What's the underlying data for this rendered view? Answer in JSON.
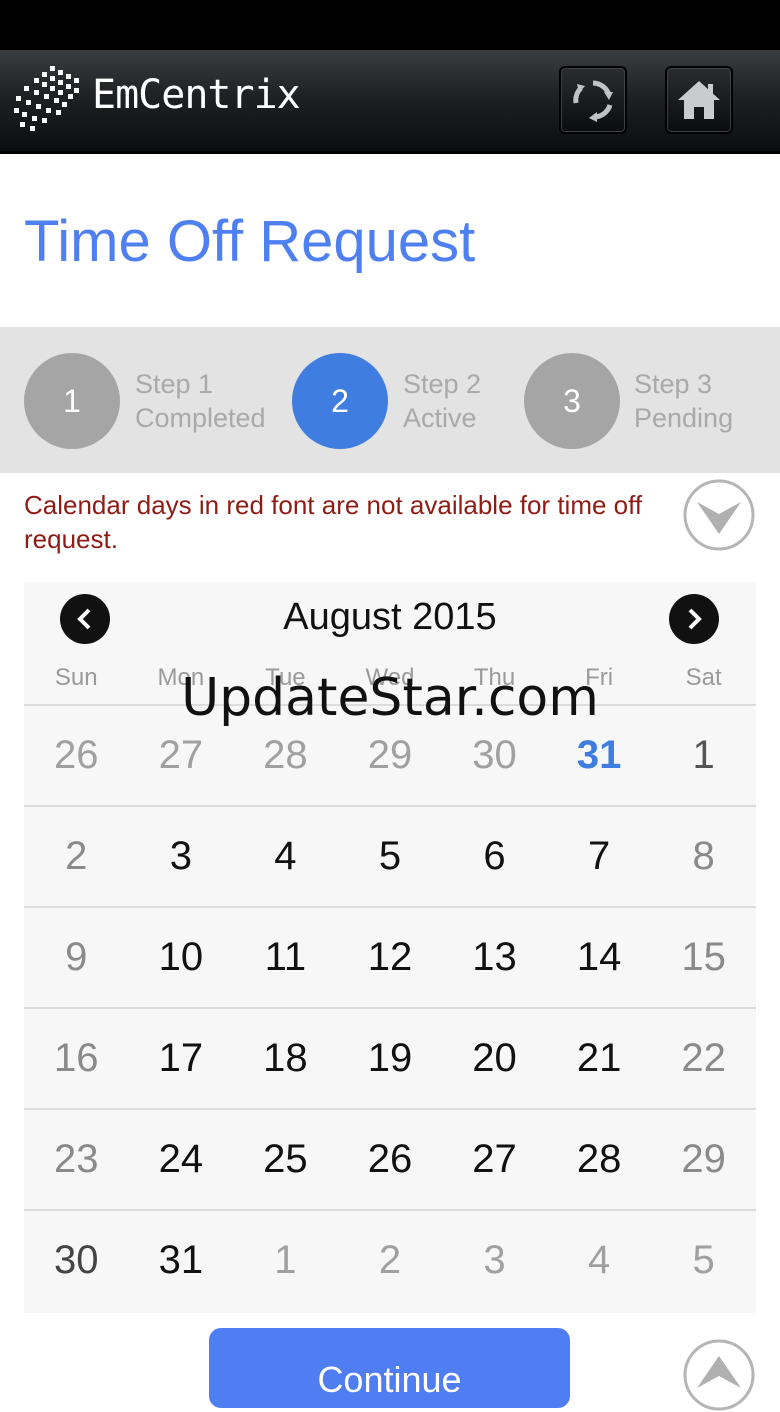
{
  "header": {
    "brand": "EmCentrix",
    "icons": {
      "logo": "emcentrix-logo-icon",
      "refresh": "refresh-icon",
      "home": "home-icon"
    }
  },
  "page": {
    "title": "Time Off Request"
  },
  "steps": [
    {
      "number": "1",
      "line1": "Step 1",
      "line2": "Completed",
      "state": "completed"
    },
    {
      "number": "2",
      "line1": "Step 2",
      "line2": "Active",
      "state": "active"
    },
    {
      "number": "3",
      "line1": "Step 3",
      "line2": "Pending",
      "state": "pending"
    }
  ],
  "notice": {
    "text": "Calendar days in red font are not available for time off request.",
    "color": "#8f1c14"
  },
  "calendar": {
    "month_label": "August 2015",
    "weekdays": [
      "Sun",
      "Mon",
      "Tue",
      "Wed",
      "Thu",
      "Fri",
      "Sat"
    ],
    "weeks": [
      [
        "26",
        "27",
        "28",
        "29",
        "30",
        "31",
        "1"
      ],
      [
        "2",
        "3",
        "4",
        "5",
        "6",
        "7",
        "8"
      ],
      [
        "9",
        "10",
        "11",
        "12",
        "13",
        "14",
        "15"
      ],
      [
        "16",
        "17",
        "18",
        "19",
        "20",
        "21",
        "22"
      ],
      [
        "23",
        "24",
        "25",
        "26",
        "27",
        "28",
        "29"
      ],
      [
        "30",
        "31",
        "1",
        "2",
        "3",
        "4",
        "5"
      ]
    ],
    "icons": {
      "prev": "chevron-left-icon",
      "next": "chevron-right-icon"
    }
  },
  "actions": {
    "continue_label": "Continue"
  },
  "watermark": "UpdateStar.com",
  "colors": {
    "accent": "#4f80f2",
    "active_step": "#3f7ee0",
    "button": "#4f7ef3"
  }
}
